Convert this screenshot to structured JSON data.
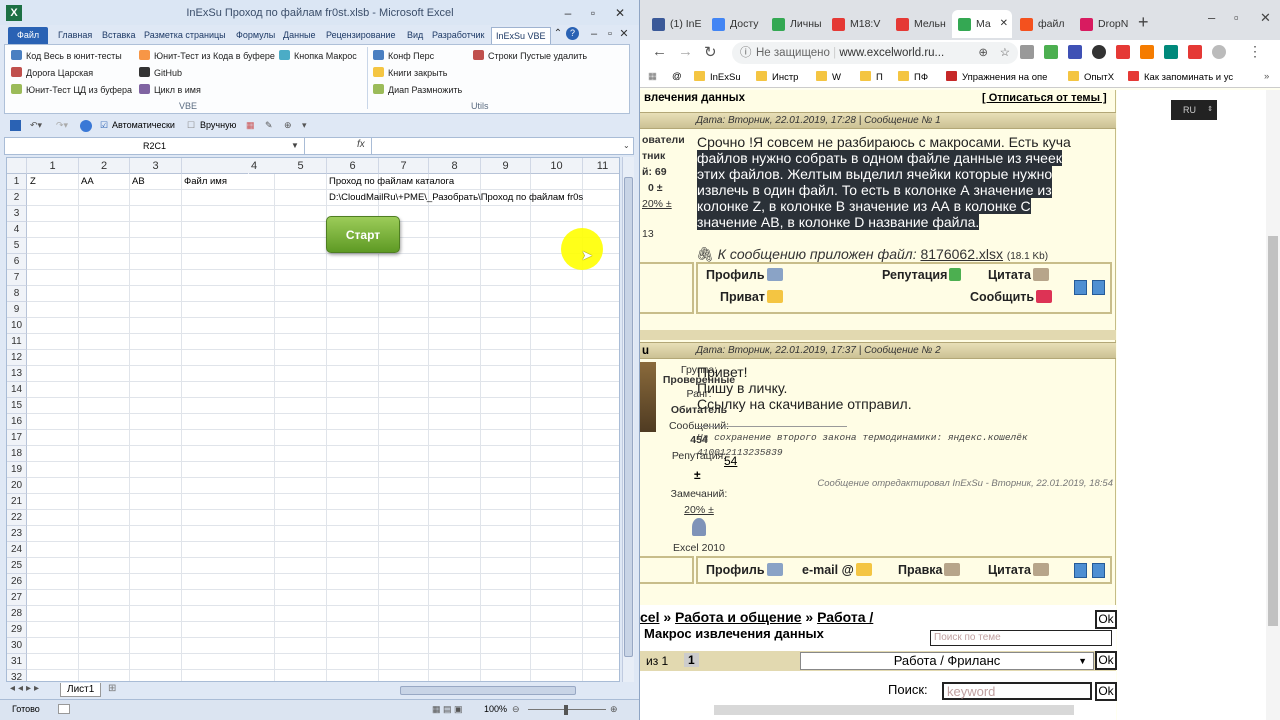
{
  "excel": {
    "title": "InExSu Проход по файлам fr0st.xlsb  -  Microsoft Excel",
    "tabs": [
      "Файл",
      "Главная",
      "Вставка",
      "Разметка страницы",
      "Формулы",
      "Данные",
      "Рецензирование",
      "Вид",
      "Разработчик",
      "InExSu VBE"
    ],
    "ribbon": {
      "col1": [
        "Код Весь в юнит-тесты",
        "Дорога Царская",
        "Юнит-Тест ЦД из буфера"
      ],
      "col2": [
        "Юнит-Тест из Кода в буфере",
        "GitHub",
        "Цикл в имя"
      ],
      "col3": [
        "Кнопка Макрос"
      ],
      "col4": [
        "Конф Перс",
        "Книги закрыть",
        "Диап Размножить"
      ],
      "col5": [
        "Строки Пустые удалить"
      ],
      "group_vbe": "VBE",
      "group_utils": "Utils"
    },
    "qat": {
      "auto": "Автоматически",
      "manual": "Вручную"
    },
    "namebox": "R2C1",
    "fx": "fx",
    "columns": [
      "1",
      "2",
      "3",
      "4",
      "5",
      "6",
      "7",
      "8",
      "9",
      "10",
      "11"
    ],
    "row1": {
      "c1": "Z",
      "c2": "AA",
      "c3": "AB",
      "c4": "Файл имя",
      "c6": "Проход по файлам каталога"
    },
    "row2": {
      "c6": "D:\\CloudMailRu\\+PME\\_Разобрать\\Проход по файлам fr0s"
    },
    "start_button": "Старт",
    "sheet_tab": "Лист1",
    "status_ready": "Готово",
    "zoom": "100%"
  },
  "browser": {
    "tabs": [
      {
        "label": "(1) InE",
        "color": "#3b5998"
      },
      {
        "label": "Досту",
        "color": "#4285f4"
      },
      {
        "label": "Личны",
        "color": "#34a853"
      },
      {
        "label": "M18:V",
        "color": "#e53935"
      },
      {
        "label": "Мельн",
        "color": "#e53935"
      },
      {
        "label": "Ма",
        "color": "#34a853"
      },
      {
        "label": "файл",
        "color": "#f4511e"
      },
      {
        "label": "DropN",
        "color": "#d81b60"
      }
    ],
    "address": {
      "prefix": "Не защищено",
      "url": "www.excelworld.ru..."
    },
    "bookmarks": [
      "@",
      "InExSu",
      "Инстр",
      "W",
      "П",
      "ПФ",
      "Упражнения на опе",
      "ОпытХ",
      "Как запоминать и ус"
    ],
    "lang_badge": "RU",
    "topic_title": "влечения данных",
    "unsubscribe": "[ Отписаться от темы ]",
    "post1": {
      "header": "Дата: Вторник, 22.01.2019, 17:28 | Сообщение № 1",
      "lines": [
        "Срочно !Я совсем не разбираюсь с макросами. Есть куча",
        "файлов нужно собрать в одном файле данные из ячеек",
        "этих файлов. Желтым выделил ячейки которые нужно",
        "извлечь в один файл. То есть в колонке А значение из",
        "колонке Z, в колонке B значение из АА в колонке С",
        "значение АВ, в колонке D название файла."
      ],
      "attach_label": "К сообщению приложен файл:",
      "attach_file": "8176062.xlsx",
      "attach_size": "(18.1 Kb)",
      "side": [
        "ователи",
        "тник",
        "й: 69",
        "0 ±",
        "20% ±",
        "13"
      ],
      "profile": "Профиль",
      "reputation": "Репутация",
      "quote": "Цитата",
      "private": "Приват",
      "message": "Сообщить"
    },
    "post2": {
      "user": "u",
      "header": "Дата: Вторник, 22.01.2019, 17:37 | Сообщение № 2",
      "lines": [
        "Привет!",
        "Пишу в личку.",
        "Ссылку на скачивание отправил."
      ],
      "signature1": "На сохранение второго закона термодинамики: яндекс.кошелёк",
      "signature2": "410012113235839",
      "edited": "Сообщение отредактировал InExSu - Вторник, 22.01.2019, 18:54",
      "side": [
        "Группа:",
        "Проверенные",
        "Ранг:",
        "Обитатель",
        "Сообщений:",
        "454",
        "Репутация:",
        "54",
        "±",
        "Замечаний:",
        "20% ±",
        "Excel 2010"
      ],
      "profile": "Профиль",
      "email": "e-mail",
      "edit": "Правка",
      "quote": "Цитата"
    },
    "breadcrumb": {
      "a": "cel",
      "b": "Работа и общение",
      "c": "Работа /",
      "d": "Макрос извлечения данных",
      "sep": "»"
    },
    "topic_search_placeholder": "Поиск по теме",
    "pager": {
      "of": "из 1",
      "page": "1"
    },
    "forum_select": "Работа / Фриланс",
    "search_label": "Поиск:",
    "search_placeholder": "keyword",
    "ok": "Ok"
  }
}
